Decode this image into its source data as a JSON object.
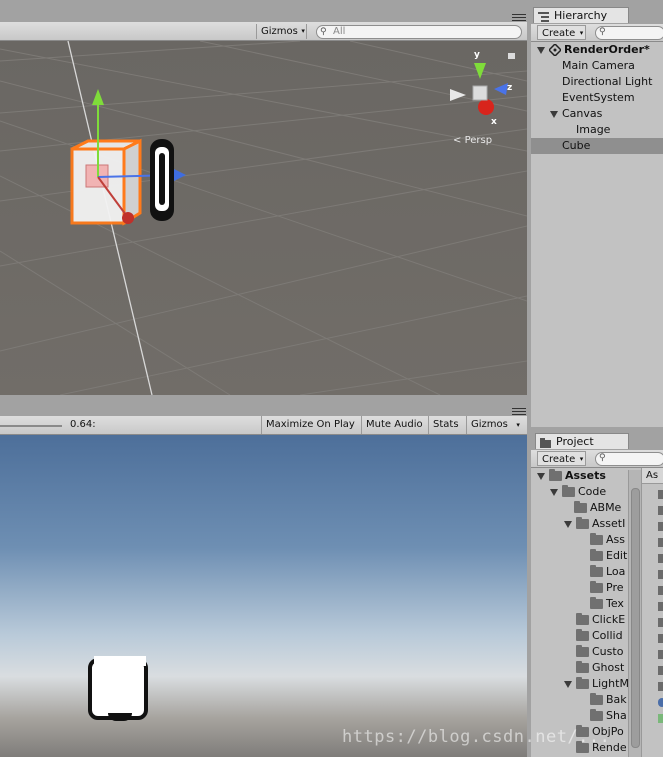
{
  "scene": {
    "gizmos_label": "Gizmos",
    "search_text": "All",
    "persp_label": "Persp",
    "axis_labels": {
      "y": "y",
      "z": "z",
      "x": "x"
    }
  },
  "game": {
    "scale_value": "0.64:",
    "buttons": [
      "Maximize On Play",
      "Mute Audio",
      "Stats",
      "Gizmos"
    ]
  },
  "hierarchy": {
    "tab_label": "Hierarchy",
    "create_label": "Create",
    "scene_name": "RenderOrder*",
    "items": [
      "Main Camera",
      "Directional Light",
      "EventSystem",
      "Canvas",
      "Image",
      "Cube"
    ],
    "selected": "Cube"
  },
  "project": {
    "tab_label": "Project",
    "create_label": "Create",
    "tree": [
      "Assets",
      "Code",
      "ABMe",
      "AssetI",
      "Ass",
      "Edit",
      "Loa",
      "Pre",
      "Tex",
      "ClickE",
      "Collid",
      "Custo",
      "Ghost",
      "LightM",
      "Bak",
      "Sha",
      "ObjPo",
      "Rende"
    ],
    "right_header": "As"
  },
  "watermark": "https://blog.csdn.net/..."
}
